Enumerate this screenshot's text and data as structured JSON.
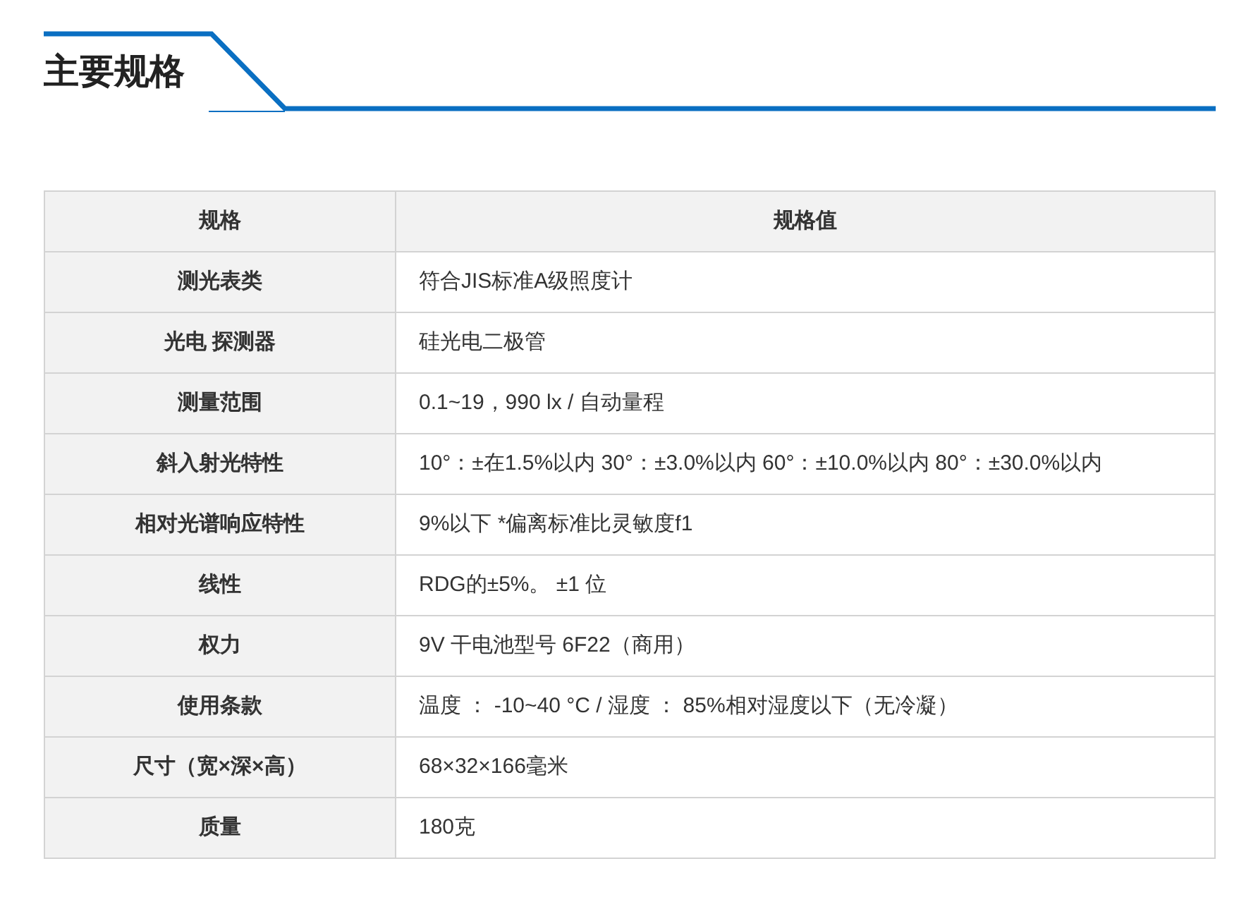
{
  "title": "主要规格",
  "table": {
    "columns": [
      "规格",
      "规格值"
    ],
    "rows": [
      {
        "name": "测光表类",
        "value": "符合JIS标准A级照度计"
      },
      {
        "name": "光电 探测器",
        "value": "硅光电二极管"
      },
      {
        "name": "测量范围",
        "value": "0.1~19，990 lx / 自动量程"
      },
      {
        "name": "斜入射光特性",
        "value": "10°：±在1.5%以内 30°：±3.0%以内 60°：±10.0%以内 80°：±30.0%以内"
      },
      {
        "name": "相对光谱响应特性",
        "value": "9%以下 *偏离标准比灵敏度f1"
      },
      {
        "name": "线性",
        "value": "RDG的±5%。 ±1 位"
      },
      {
        "name": "权力",
        "value": "9V 干电池型号 6F22（商用）"
      },
      {
        "name": "使用条款",
        "value": "温度 ： -10~40 °C / 湿度 ： 85%相对湿度以下（无冷凝）"
      },
      {
        "name": "尺寸（宽×深×高）",
        "value": "68×32×166毫米"
      },
      {
        "name": "质量",
        "value": "180克"
      }
    ]
  }
}
